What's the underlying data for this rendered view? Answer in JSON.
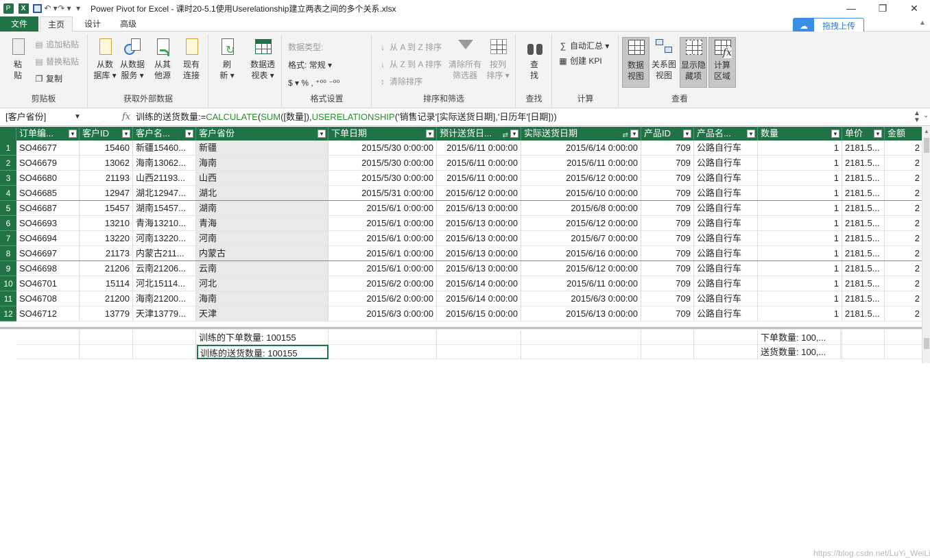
{
  "window": {
    "title": "Power Pivot for Excel - 课时20-5.1使用Userelationship建立两表之间的多个关系.xlsx",
    "controls": {
      "minimize": "—",
      "restore": "❐",
      "close": "✕"
    }
  },
  "tabs": {
    "file": "文件",
    "home": "主页",
    "design": "设计",
    "advanced": "高级"
  },
  "upload_button": {
    "label": "拖拽上传"
  },
  "ribbon": {
    "clipboard": {
      "label": "剪贴板",
      "paste_line1": "粘",
      "paste_line2": "贴",
      "paste_append": "追加粘贴",
      "paste_replace": "替换粘贴",
      "copy": "复制"
    },
    "external": {
      "label": "获取外部数据",
      "from_db_1": "从数",
      "from_db_2": "据库 ▾",
      "from_service_1": "从数据",
      "from_service_2": "服务 ▾",
      "from_other_1": "从其",
      "from_other_2": "他源",
      "existing_1": "现有",
      "existing_2": "连接"
    },
    "refresh": {
      "line1": "刷",
      "line2": "新 ▾"
    },
    "pivot": {
      "line1": "数据透",
      "line2": "视表 ▾"
    },
    "format": {
      "label": "格式设置",
      "datatype": "数据类型:",
      "format": "格式: 常规 ▾",
      "symbols": "$ ▾ %  ,  ⁺⁰⁰ ⁻⁰⁰"
    },
    "sort": {
      "label": "排序和筛选",
      "az": "从 A 到 Z 排序",
      "za": "从 Z 到 A 排序",
      "clear_sort": "清除排序",
      "clear_filters_1": "清除所有",
      "clear_filters_2": "筛选器",
      "by_col_1": "按列",
      "by_col_2": "排序 ▾"
    },
    "find": {
      "label": "查找",
      "line1": "查",
      "line2": "找"
    },
    "calc": {
      "label": "计算",
      "autosum": "自动汇总 ▾",
      "kpi": "创建 KPI"
    },
    "view": {
      "label": "查看",
      "data_view_1": "数据",
      "data_view_2": "视图",
      "diagram_1": "关系图",
      "diagram_2": "视图",
      "hidden_1": "显示隐",
      "hidden_2": "藏项",
      "calc_area_1": "计算",
      "calc_area_2": "区域"
    }
  },
  "formula_bar": {
    "name_box": "[客户省份]",
    "fx": "fx",
    "parts": {
      "p1": "训练的送货数量:=",
      "p2": "CALCULATE",
      "p3": "(",
      "p4": "SUM",
      "p5": "([数量]),",
      "p6": "USERELATIONSHIP",
      "p7": "('销售记录'[实际送货日期],'日历年'[日期]))"
    }
  },
  "table": {
    "columns": [
      "订单编...",
      "客户ID",
      "客户名...",
      "客户省份",
      "下单日期",
      "预计送货日...",
      "实际送货日期",
      "产品ID",
      "产品名...",
      "数量",
      "单价",
      "金额"
    ],
    "rows": [
      [
        "1",
        "SO46677",
        "15460",
        "新疆15460...",
        "新疆",
        "2015/5/30 0:00:00",
        "2015/6/11 0:00:00",
        "2015/6/14 0:00:00",
        "709",
        "公路自行车",
        "1",
        "2181.5...",
        "2"
      ],
      [
        "2",
        "SO46679",
        "13062",
        "海南13062...",
        "海南",
        "2015/5/30 0:00:00",
        "2015/6/11 0:00:00",
        "2015/6/11 0:00:00",
        "709",
        "公路自行车",
        "1",
        "2181.5...",
        "2"
      ],
      [
        "3",
        "SO46680",
        "21193",
        "山西21193...",
        "山西",
        "2015/5/30 0:00:00",
        "2015/6/11 0:00:00",
        "2015/6/12 0:00:00",
        "709",
        "公路自行车",
        "1",
        "2181.5...",
        "2"
      ],
      [
        "4",
        "SO46685",
        "12947",
        "湖北12947...",
        "湖北",
        "2015/5/31 0:00:00",
        "2015/6/12 0:00:00",
        "2015/6/10 0:00:00",
        "709",
        "公路自行车",
        "1",
        "2181.5...",
        "2"
      ],
      [
        "5",
        "SO46687",
        "15457",
        "湖南15457...",
        "湖南",
        "2015/6/1 0:00:00",
        "2015/6/13 0:00:00",
        "2015/6/8 0:00:00",
        "709",
        "公路自行车",
        "1",
        "2181.5...",
        "2"
      ],
      [
        "6",
        "SO46693",
        "13210",
        "青海13210...",
        "青海",
        "2015/6/1 0:00:00",
        "2015/6/13 0:00:00",
        "2015/6/12 0:00:00",
        "709",
        "公路自行车",
        "1",
        "2181.5...",
        "2"
      ],
      [
        "7",
        "SO46694",
        "13220",
        "河南13220...",
        "河南",
        "2015/6/1 0:00:00",
        "2015/6/13 0:00:00",
        "2015/6/7 0:00:00",
        "709",
        "公路自行车",
        "1",
        "2181.5...",
        "2"
      ],
      [
        "8",
        "SO46697",
        "21173",
        "内蒙古211...",
        "内蒙古",
        "2015/6/1 0:00:00",
        "2015/6/13 0:00:00",
        "2015/6/16 0:00:00",
        "709",
        "公路自行车",
        "1",
        "2181.5...",
        "2"
      ],
      [
        "9",
        "SO46698",
        "21206",
        "云南21206...",
        "云南",
        "2015/6/1 0:00:00",
        "2015/6/13 0:00:00",
        "2015/6/12 0:00:00",
        "709",
        "公路自行车",
        "1",
        "2181.5...",
        "2"
      ],
      [
        "10",
        "SO46701",
        "15114",
        "河北15114...",
        "河北",
        "2015/6/2 0:00:00",
        "2015/6/14 0:00:00",
        "2015/6/11 0:00:00",
        "709",
        "公路自行车",
        "1",
        "2181.5...",
        "2"
      ],
      [
        "11",
        "SO46708",
        "21200",
        "海南21200...",
        "海南",
        "2015/6/2 0:00:00",
        "2015/6/14 0:00:00",
        "2015/6/3 0:00:00",
        "709",
        "公路自行车",
        "1",
        "2181.5...",
        "2"
      ],
      [
        "12",
        "SO46712",
        "13779",
        "天津13779...",
        "天津",
        "2015/6/3 0:00:00",
        "2015/6/15 0:00:00",
        "2015/6/13 0:00:00",
        "709",
        "公路自行车",
        "1",
        "2181.5...",
        "2"
      ]
    ]
  },
  "measures": {
    "order_qty": "训练的下单数量: 100155",
    "delivery_qty": "训练的送货数量: 100155",
    "order_count": "下单数量: 100,...",
    "delivery_count": "送货数量: 100,..."
  },
  "watermark": "https://blog.csdn.net/LuYi_WeiLin",
  "colors": {
    "accent": "#217346",
    "formula_function": "#2b8a2b"
  }
}
